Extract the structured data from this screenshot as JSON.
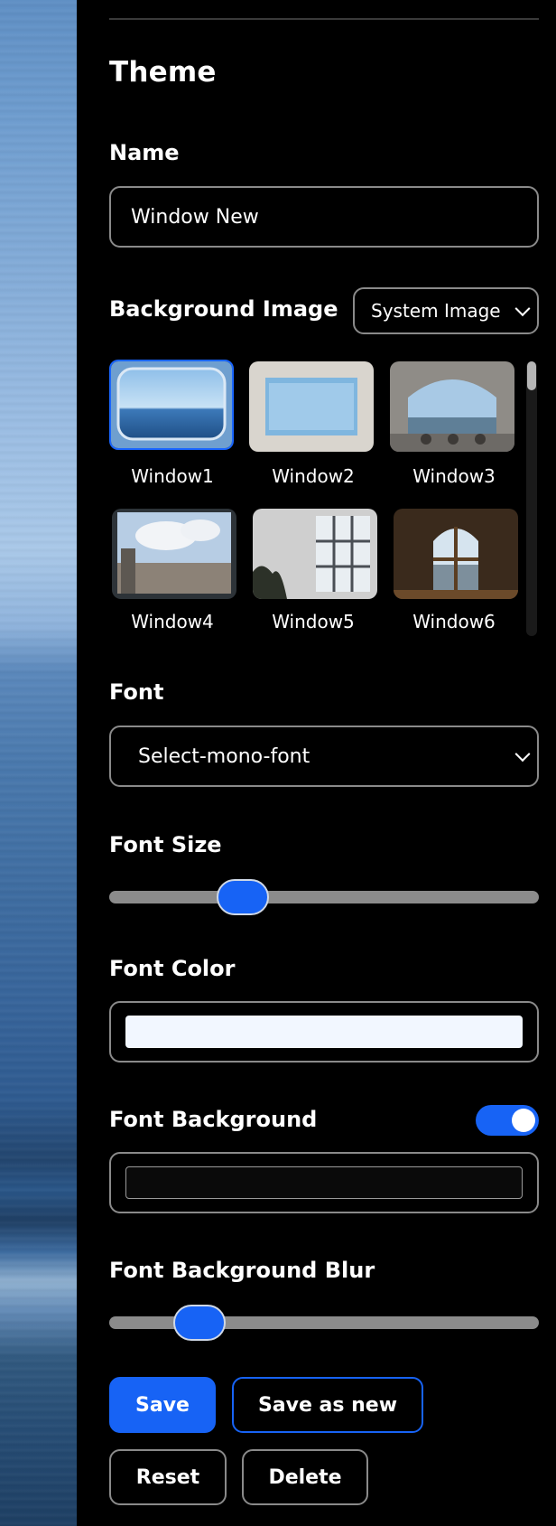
{
  "theme": {
    "title": "Theme",
    "name_label": "Name",
    "name_value": "Window New",
    "bg_label": "Background Image",
    "bg_source": "System Image",
    "images": [
      {
        "label": "Window1",
        "selected": true
      },
      {
        "label": "Window2",
        "selected": false
      },
      {
        "label": "Window3",
        "selected": false
      },
      {
        "label": "Window4",
        "selected": false
      },
      {
        "label": "Window5",
        "selected": false
      },
      {
        "label": "Window6",
        "selected": false
      }
    ],
    "font_label": "Font",
    "font_value": "Select-mono-font",
    "font_size_label": "Font Size",
    "font_size_fraction": 0.31,
    "font_color_label": "Font Color",
    "font_color": "#f2f7ff",
    "font_bg_label": "Font Background",
    "font_bg_enabled": true,
    "font_bg_color": "#0a0a0a",
    "font_bg_blur_label": "Font Background Blur",
    "font_bg_blur_fraction": 0.21
  },
  "actions": {
    "save": "Save",
    "save_as_new": "Save as new",
    "reset": "Reset",
    "delete": "Delete"
  },
  "colors": {
    "accent": "#1763f5",
    "border": "#8a8a8a",
    "panel_bg": "#000000"
  }
}
